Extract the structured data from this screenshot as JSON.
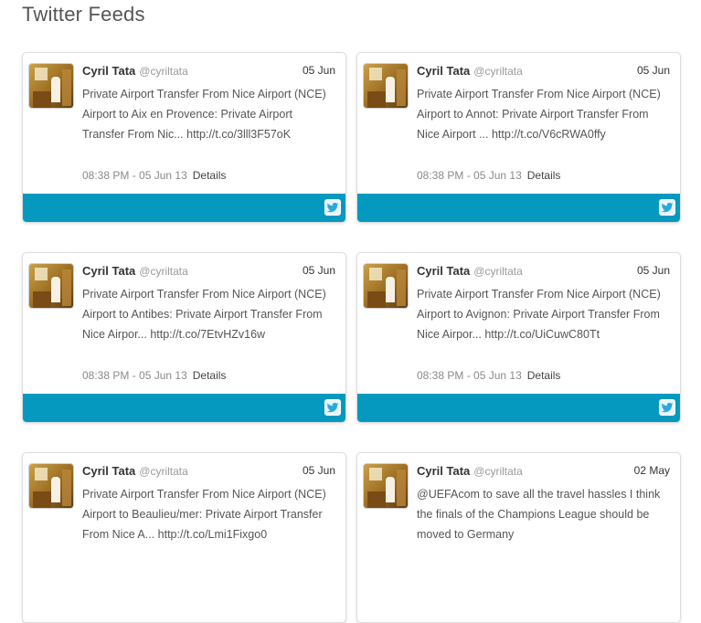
{
  "page": {
    "title": "Twitter Feeds"
  },
  "tweets": [
    {
      "name": "Cyril Tata",
      "handle": "@cyriltata",
      "date": "05 Jun",
      "lines": [
        "Private Airport Transfer From Nice Airport (NCE)",
        "Airport to Aix en Provence: Private Airport",
        "Transfer From Nic... http://t.co/3lll3F57oK"
      ],
      "time": "08:38 PM - 05 Jun 13",
      "details": "Details"
    },
    {
      "name": "Cyril Tata",
      "handle": "@cyriltata",
      "date": "05 Jun",
      "lines": [
        "Private Airport Transfer From Nice Airport (NCE)",
        "Airport to Annot: Private Airport Transfer From",
        "Nice Airport ... http://t.co/V6cRWA0ffy"
      ],
      "time": "08:38 PM - 05 Jun 13",
      "details": "Details"
    },
    {
      "name": "Cyril Tata",
      "handle": "@cyriltata",
      "date": "05 Jun",
      "lines": [
        "Private Airport Transfer From Nice Airport (NCE)",
        "Airport to Antibes: Private Airport Transfer From",
        "Nice Airpor... http://t.co/7EtvHZv16w"
      ],
      "time": "08:38 PM - 05 Jun 13",
      "details": "Details"
    },
    {
      "name": "Cyril Tata",
      "handle": "@cyriltata",
      "date": "05 Jun",
      "lines": [
        "Private Airport Transfer From Nice Airport (NCE)",
        "Airport to Avignon: Private Airport Transfer From",
        "Nice Airpor... http://t.co/UiCuwC80Tt"
      ],
      "time": "08:38 PM - 05 Jun 13",
      "details": "Details"
    },
    {
      "name": "Cyril Tata",
      "handle": "@cyriltata",
      "date": "05 Jun",
      "lines": [
        "Private Airport Transfer From Nice Airport (NCE)",
        "Airport to Beaulieu/mer: Private Airport Transfer",
        "From Nice A... http://t.co/Lmi1Fixgo0"
      ],
      "time": "",
      "details": ""
    },
    {
      "name": "Cyril Tata",
      "handle": "@cyriltata",
      "date": "02 May",
      "lines": [
        "@UEFAcom to save all the travel hassles I think",
        "the finals of the Champions League should be",
        "moved to Germany"
      ],
      "time": "",
      "details": ""
    }
  ],
  "colors": {
    "bar": "#0599bf",
    "name": "#333333",
    "text": "#555555",
    "meta": "#8a8a8a"
  },
  "icons": {
    "avatar": "avatar",
    "share": "twitter-bird-icon"
  }
}
